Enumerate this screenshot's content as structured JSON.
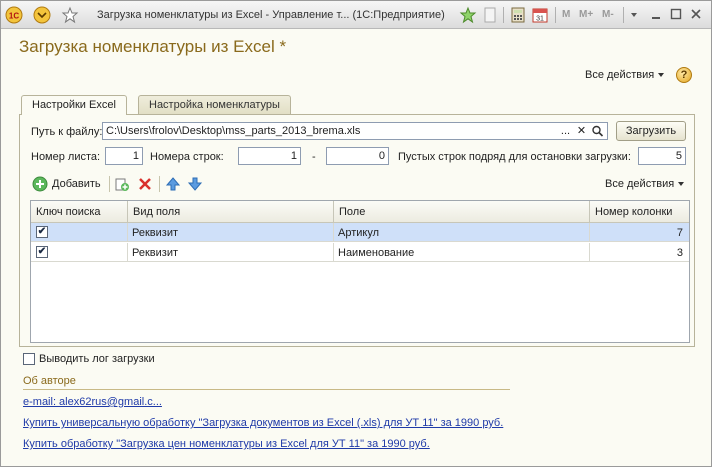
{
  "window": {
    "title": "Загрузка номенклатуры из Excel - Управление т... (1С:Предприятие)",
    "toolbar_m": [
      "M",
      "M+",
      "M-"
    ]
  },
  "page": {
    "title": "Загрузка номенклатуры из Excel *",
    "all_actions": "Все действия",
    "help": "?"
  },
  "tabs": [
    {
      "label": "Настройки Excel",
      "active": true
    },
    {
      "label": "Настройка номенклатуры",
      "active": false
    }
  ],
  "file": {
    "label": "Путь к файлу:",
    "value": "C:\\Users\\frolov\\Desktop\\mss_parts_2013_brema.xls",
    "load_button": "Загрузить",
    "btn_more": "...",
    "btn_clear": "✕"
  },
  "params": {
    "sheet_label": "Номер листа:",
    "sheet_value": "1",
    "rows_label": "Номера строк:",
    "rows_from": "1",
    "rows_dash": "-",
    "rows_to": "0",
    "empty_label": "Пустых строк подряд для остановки загрузки:",
    "empty_value": "5"
  },
  "toolbar": {
    "add_label": "Добавить",
    "all_actions": "Все действия"
  },
  "table": {
    "columns": [
      "Ключ поиска",
      "Вид поля",
      "Поле",
      "Номер колонки"
    ],
    "rows": [
      {
        "key": "✔",
        "kind": "Реквизит",
        "field": "Артикул",
        "col": "7"
      },
      {
        "key": "✔",
        "kind": "Реквизит",
        "field": "Наименование",
        "col": "3"
      }
    ]
  },
  "log_checkbox": "Выводить лог загрузки",
  "about": {
    "title": "Об авторе",
    "email": "e-mail: alex62rus@gmail.c...",
    "link1": "Купить универсальную обработку \"Загрузка документов из Excel (.xls) для УТ 11\" за 1990 руб.",
    "link2": "Купить обработку \"Загрузка цен номенклатуры из Excel для УТ 11\" за 1990 руб."
  }
}
